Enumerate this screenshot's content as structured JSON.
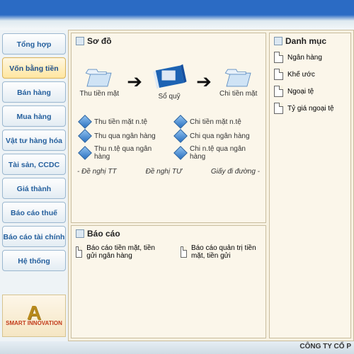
{
  "sidebar": {
    "items": [
      {
        "label": "Tổng hợp"
      },
      {
        "label": "Vốn bằng tiền",
        "active": true
      },
      {
        "label": "Bán hàng"
      },
      {
        "label": "Mua hàng"
      },
      {
        "label": "Vật tư hàng hóa"
      },
      {
        "label": "Tài sản, CCDC"
      },
      {
        "label": "Giá thành"
      },
      {
        "label": "Báo cáo thuế"
      },
      {
        "label": "Báo cáo tài chính"
      },
      {
        "label": "Hệ thống"
      }
    ],
    "logo": "SMART INNOVATION"
  },
  "diagram": {
    "title": "Sơ đồ",
    "flow": {
      "left": "Thu tiền mặt",
      "center": "Sổ quỹ",
      "right": "Chi tiền mặt"
    },
    "linksLeft": [
      "Thu tiền mặt n.tệ",
      "Thu qua ngân hàng",
      "Thu n.tệ qua ngân hàng"
    ],
    "linksRight": [
      "Chi tiền mặt n.tệ",
      "Chi qua ngân hàng",
      "Chi n.tệ qua ngân hàng"
    ],
    "bottom": {
      "left": "- Đề nghị TT",
      "center": "Đề nghị TƯ",
      "right": "Giấy đi đường -"
    }
  },
  "report": {
    "title": "Báo cáo",
    "items": [
      "Báo cáo tiền mặt, tiền gửi ngân hàng",
      "Báo cáo quản trị tiền mặt, tiền gửi"
    ]
  },
  "catalog": {
    "title": "Danh mục",
    "items": [
      "Ngân hàng",
      "Khế ước",
      "Ngoại tệ",
      "Tỷ giá ngoại tệ"
    ]
  },
  "footer": "CÔNG TY CỔ P"
}
